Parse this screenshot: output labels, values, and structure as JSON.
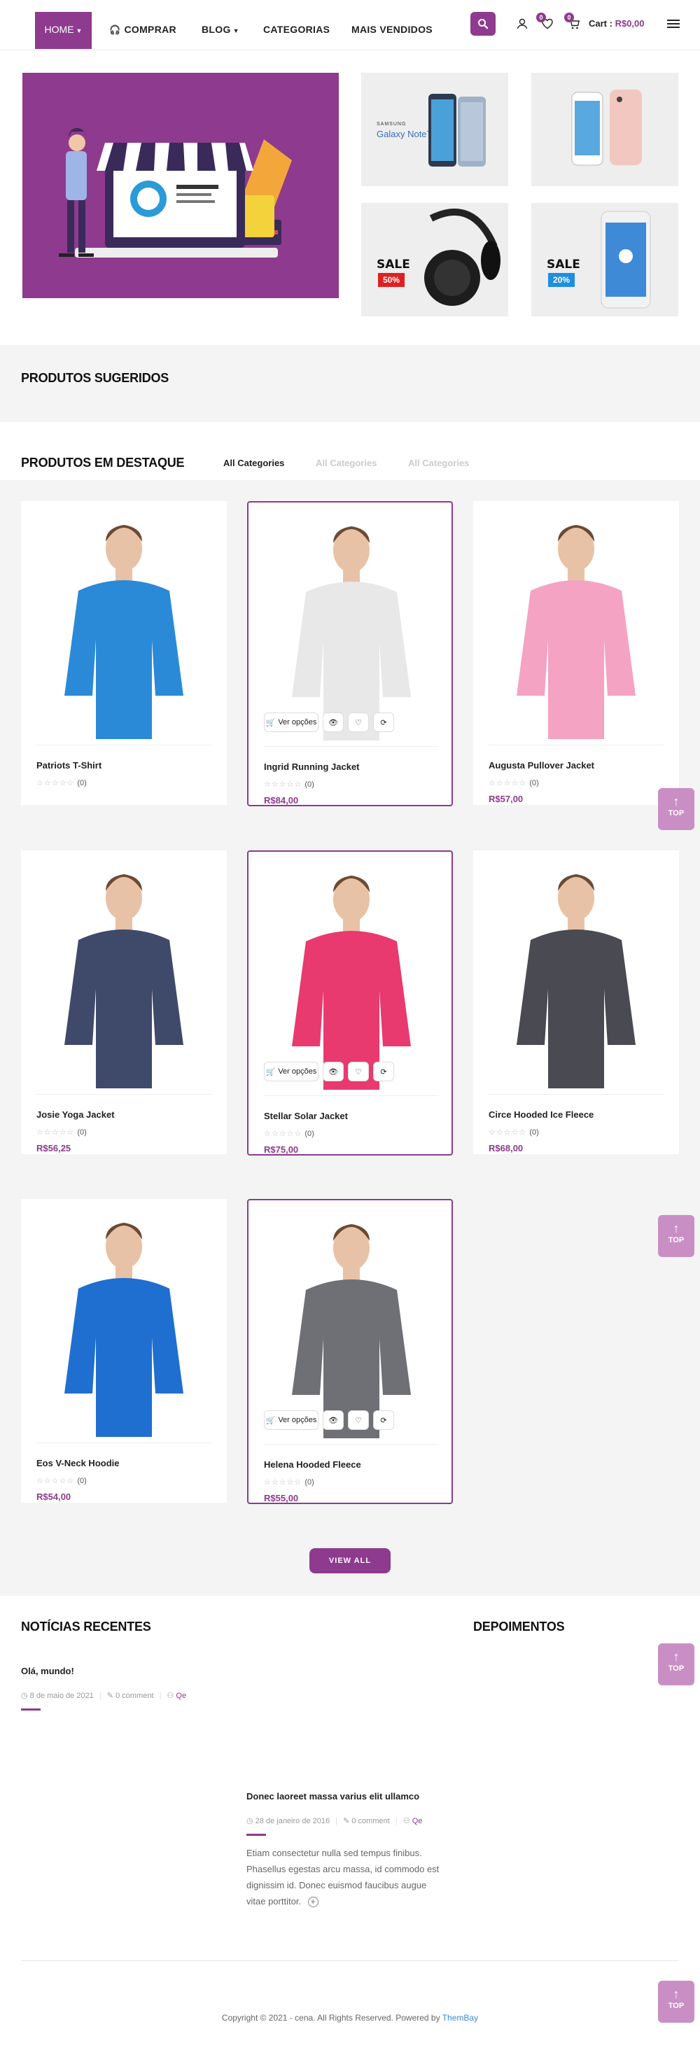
{
  "nav": {
    "home": "HOME",
    "comprar": "COMPRAR",
    "blog": "BLOG",
    "categorias": "CATEGORIAS",
    "mais_vendidos": "MAIS VENDIDOS",
    "wishlist_count": "0",
    "compare_count": "0",
    "cart_label": "Cart :",
    "cart_amount": "R$0,00"
  },
  "banners": {
    "galaxy_brand": "SAMSUNG",
    "galaxy_name": "Galaxy Note7",
    "headphone_sale": "SALE",
    "headphone_pct": "50%",
    "pixel_sale": "SALE",
    "pixel_pct": "20%"
  },
  "sections": {
    "suggested": "PRODUTOS SUGERIDOS",
    "featured": "PRODUTOS EM DESTAQUE",
    "tabs": [
      "All Categories",
      "All Categories",
      "All Categories"
    ],
    "view_all": "VIEW ALL",
    "news": "NOTÍCIAS RECENTES",
    "testimonials": "DEPOIMENTOS",
    "top": "TOP"
  },
  "product_actions": {
    "options": "Ver opções"
  },
  "products": [
    {
      "name": "Patriots T-Shirt",
      "reviews": "(0)",
      "price": "",
      "color": "#2a8ad8",
      "selected": false
    },
    {
      "name": "Ingrid Running Jacket",
      "reviews": "(0)",
      "price": "R$84,00",
      "color": "#e8e8e8",
      "selected": true
    },
    {
      "name": "Augusta Pullover Jacket",
      "reviews": "(0)",
      "price": "R$57,00",
      "color": "#f5a3c2",
      "selected": false
    },
    {
      "name": "Josie Yoga Jacket",
      "reviews": "(0)",
      "price": "R$56,25",
      "color": "#3f4a6b",
      "selected": false
    },
    {
      "name": "Stellar Solar Jacket",
      "reviews": "(0)",
      "price": "R$75,00",
      "color": "#e83a6e",
      "selected": true
    },
    {
      "name": "Circe Hooded Ice Fleece",
      "reviews": "(0)",
      "price": "R$68,00",
      "color": "#4a4a52",
      "selected": false
    },
    {
      "name": "Eos V-Neck Hoodie",
      "reviews": "(0)",
      "price": "R$54,00",
      "color": "#1e6fd0",
      "selected": false
    },
    {
      "name": "Helena Hooded Fleece",
      "reviews": "(0)",
      "price": "R$55,00",
      "color": "#6e7075",
      "selected": true
    }
  ],
  "news": [
    {
      "title": "Olá, mundo!",
      "date": "8 de maio de 2021",
      "comments": "0 comment",
      "author": "Qe"
    }
  ],
  "testimonial_post": {
    "title": "Donec laoreet massa varius elit ullamco",
    "date": "28 de janeiro de 2016",
    "comments": "0 comment",
    "author": "Qe",
    "body_lines": [
      "Etiam consectetur nulla sed tempus finibus.",
      "Phasellus egestas arcu massa, id commodo est",
      "dignissim id. Donec euismod faucibus augue",
      "vitae porttitor."
    ]
  },
  "footer": {
    "copyright": "Copyright © 2021 - cena. All Rights Reserved. Powered by",
    "powered_by": "ThemBay"
  },
  "colors": {
    "accent": "#8e3a8e",
    "top_button": "#c98fc4",
    "band": "#f4f4f4"
  }
}
